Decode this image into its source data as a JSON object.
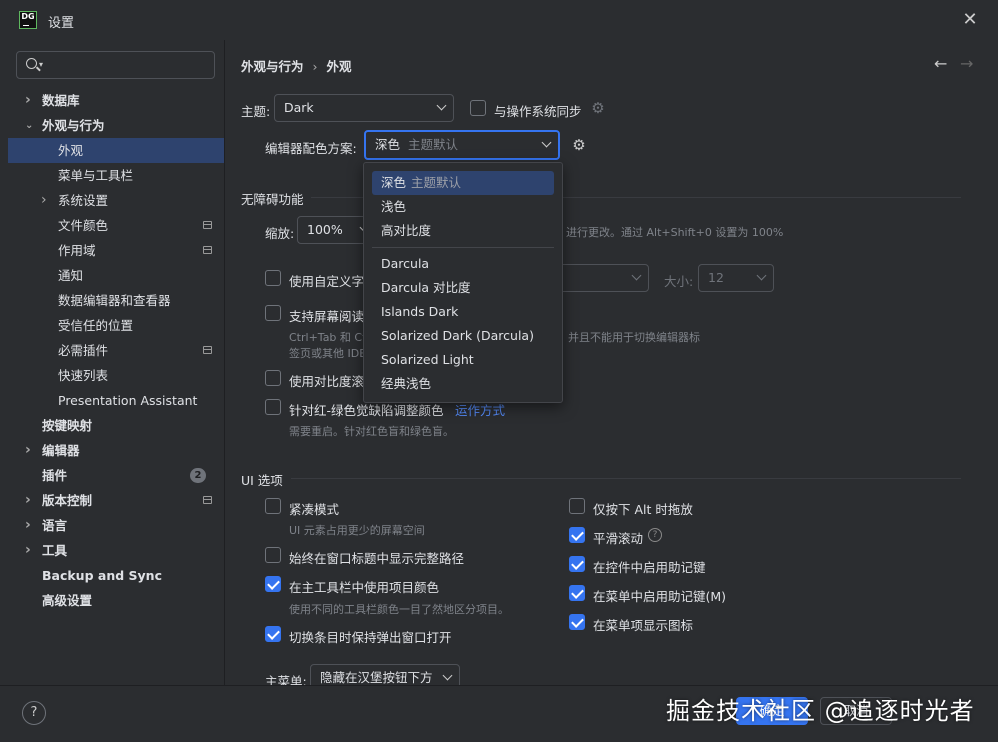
{
  "window": {
    "title": "设置",
    "app_icon_text": "DG"
  },
  "search": {
    "placeholder": "",
    "value": ""
  },
  "sidebar": {
    "items": [
      {
        "label": "数据库",
        "level": 0,
        "chevron": "right"
      },
      {
        "label": "外观与行为",
        "level": 0,
        "chevron": "down"
      },
      {
        "label": "外观",
        "level": 1,
        "selected": true
      },
      {
        "label": "菜单与工具栏",
        "level": 1
      },
      {
        "label": "系统设置",
        "level": 1,
        "chevron": "right"
      },
      {
        "label": "文件颜色",
        "level": 1,
        "badge": true
      },
      {
        "label": "作用域",
        "level": 1,
        "badge": true
      },
      {
        "label": "通知",
        "level": 1
      },
      {
        "label": "数据编辑器和查看器",
        "level": 1
      },
      {
        "label": "受信任的位置",
        "level": 1
      },
      {
        "label": "必需插件",
        "level": 1,
        "badge": true
      },
      {
        "label": "快速列表",
        "level": 1
      },
      {
        "label": "Presentation Assistant",
        "level": 1
      },
      {
        "label": "按键映射",
        "level": 0
      },
      {
        "label": "编辑器",
        "level": 0,
        "chevron": "right"
      },
      {
        "label": "插件",
        "level": 0,
        "count": "2"
      },
      {
        "label": "版本控制",
        "level": 0,
        "chevron": "right",
        "badge": true
      },
      {
        "label": "语言",
        "level": 0,
        "chevron": "right"
      },
      {
        "label": "工具",
        "level": 0,
        "chevron": "right"
      },
      {
        "label": "Backup and Sync",
        "level": 0
      },
      {
        "label": "高级设置",
        "level": 0
      }
    ]
  },
  "breadcrumb": {
    "parent": "外观与行为",
    "separator": "›",
    "current": "外观"
  },
  "theme": {
    "label": "主题:",
    "value": "Dark",
    "sync_label": "与操作系统同步",
    "sync_checked": false
  },
  "scheme": {
    "label": "编辑器配色方案:",
    "value": "深色",
    "value_sub": "主题默认"
  },
  "accessibility": {
    "heading": "无障碍功能",
    "zoom_label": "缩放:",
    "zoom_value": "100%",
    "zoom_hint": "进行更改。通过 Alt+Shift+0 设置为 100%",
    "custom_font_label": "使用自定义字体",
    "size_label": "大小:",
    "size_value": "12",
    "screen_reader_label": "支持屏幕阅读器",
    "screen_reader_hint1": "Ctrl+Tab 和 Ct",
    "screen_reader_hint1b": "并且不能用于切换编辑器标",
    "screen_reader_hint2": "签页或其他 IDE",
    "contrast_scroll_label": "使用对比度滚动",
    "colorblind_label": "针对红-绿色觉缺陷调整颜色",
    "colorblind_link": "运作方式",
    "colorblind_hint": "需要重启。针对红色盲和绿色盲。"
  },
  "ui_options": {
    "heading": "UI 选项",
    "compact_label": "紧凑模式",
    "compact_hint": "UI 元素占用更少的屏幕空间",
    "compact_checked": false,
    "full_path_label": "始终在窗口标题中显示完整路径",
    "full_path_checked": false,
    "project_color_label": "在主工具栏中使用项目颜色",
    "project_color_hint": "使用不同的工具栏颜色一目了然地区分项目。",
    "project_color_checked": true,
    "keep_popup_label": "切换条目时保持弹出窗口打开",
    "keep_popup_checked": true,
    "alt_drag_label": "仅按下 Alt 时拖放",
    "alt_drag_checked": false,
    "smooth_scroll_label": "平滑滚动",
    "smooth_scroll_checked": true,
    "mnemonic_controls_label": "在控件中启用助记键",
    "mnemonic_controls_checked": true,
    "mnemonic_menus_label": "在菜单中启用助记键(M)",
    "mnemonic_menus_checked": true,
    "menu_icons_label": "在菜单项显示图标",
    "menu_icons_checked": true,
    "main_menu_label": "主菜单:",
    "main_menu_value": "隐藏在汉堡按钮下方"
  },
  "scheme_popup": {
    "options_top": [
      {
        "main": "深色",
        "sub": "主题默认",
        "highlighted": true
      },
      {
        "main": "浅色",
        "sub": ""
      },
      {
        "main": "高对比度",
        "sub": ""
      }
    ],
    "options_bottom": [
      {
        "main": "Darcula",
        "sub": ""
      },
      {
        "main": "Darcula 对比度",
        "sub": ""
      },
      {
        "main": "Islands Dark",
        "sub": ""
      },
      {
        "main": "Solarized Dark (Darcula)",
        "sub": ""
      },
      {
        "main": "Solarized Light",
        "sub": ""
      },
      {
        "main": "经典浅色",
        "sub": ""
      }
    ]
  },
  "footer": {
    "help_label": "?",
    "ok_label": "确定",
    "cancel_label": "取消",
    "watermark": "掘金技术社区 @追逐时光者"
  },
  "colors": {
    "accent": "#3574f0",
    "selection": "#2e436e",
    "background": "#2b2d30",
    "link": "#548af7"
  }
}
